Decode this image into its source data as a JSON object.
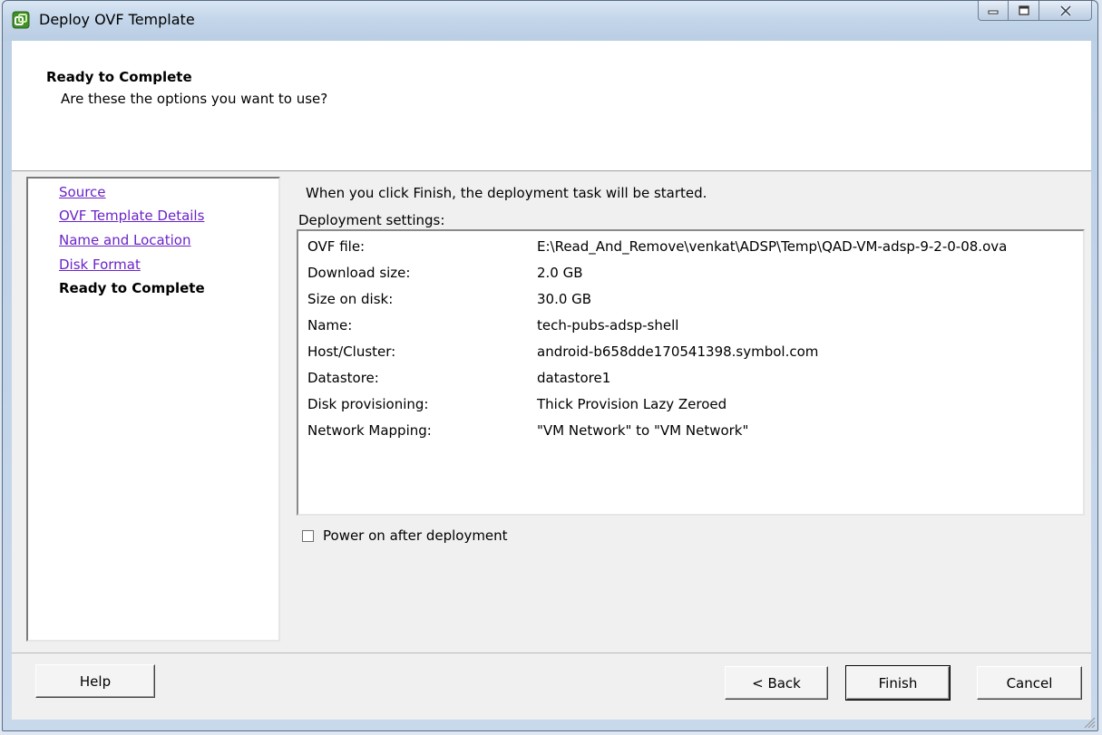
{
  "window": {
    "title": "Deploy OVF Template"
  },
  "header": {
    "title": "Ready to Complete",
    "subtitle": "Are these the options you want to use?"
  },
  "nav": {
    "items": [
      {
        "label": "Source",
        "current": false
      },
      {
        "label": "OVF Template Details",
        "current": false
      },
      {
        "label": "Name and Location",
        "current": false
      },
      {
        "label": "Disk Format",
        "current": false
      },
      {
        "label": "Ready to Complete",
        "current": true
      }
    ]
  },
  "main": {
    "intro": "When you click Finish, the deployment task will be started.",
    "settings_label": "Deployment settings:",
    "settings": [
      {
        "key": "OVF file:",
        "value": "E:\\Read_And_Remove\\venkat\\ADSP\\Temp\\QAD-VM-adsp-9-2-0-08.ova"
      },
      {
        "key": "Download size:",
        "value": "2.0 GB"
      },
      {
        "key": "Size on disk:",
        "value": "30.0 GB"
      },
      {
        "key": "Name:",
        "value": "tech-pubs-adsp-shell"
      },
      {
        "key": "Host/Cluster:",
        "value": "android-b658dde170541398.symbol.com"
      },
      {
        "key": "Datastore:",
        "value": "datastore1"
      },
      {
        "key": "Disk provisioning:",
        "value": "Thick Provision Lazy Zeroed"
      },
      {
        "key": "Network Mapping:",
        "value": "\"VM Network\" to \"VM Network\""
      }
    ],
    "power_on_label": "Power on after deployment",
    "power_on_checked": false
  },
  "footer": {
    "help_label": "Help",
    "back_label": "< Back",
    "finish_label": "Finish",
    "cancel_label": "Cancel"
  },
  "colors": {
    "link": "#6b24c8",
    "titlebar": "#c4d6ea"
  }
}
